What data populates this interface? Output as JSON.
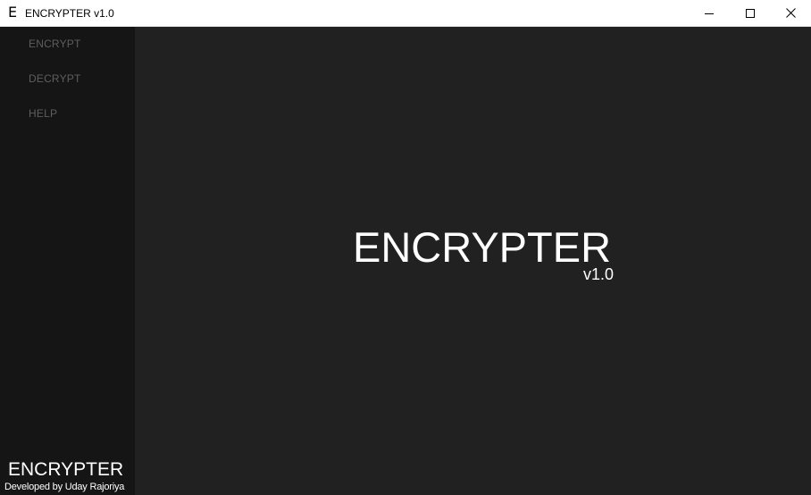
{
  "window": {
    "icon_glyph": "E",
    "title": "ENCRYPTER v1.0",
    "controls": {
      "minimize": "minimize-icon",
      "maximize": "maximize-icon",
      "close": "close-icon"
    }
  },
  "sidebar": {
    "items": [
      {
        "label": "ENCRYPT"
      },
      {
        "label": "DECRYPT"
      },
      {
        "label": "HELP"
      }
    ],
    "brand": "ENCRYPTER",
    "credit": "Developed by Uday Rajoriya"
  },
  "main": {
    "title": "ENCRYPTER",
    "version": "v1.0"
  },
  "colors": {
    "titlebar_bg": "#ffffff",
    "sidebar_bg": "#151515",
    "main_bg": "#212121",
    "nav_text": "#5e5e5e",
    "hero_text": "#ffffff"
  }
}
